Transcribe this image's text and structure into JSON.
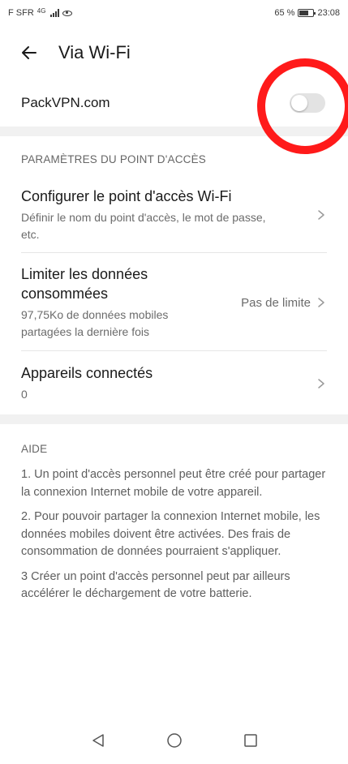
{
  "statusbar": {
    "carrier": "F SFR",
    "network": "4G",
    "battery": "65 %",
    "time": "23:08",
    "icons": [
      "signal-icon",
      "eye-icon",
      "battery-icon"
    ]
  },
  "appbar": {
    "title": "Via Wi-Fi",
    "back_icon": "back-arrow-icon"
  },
  "vpn": {
    "label": "PackVPN.com",
    "toggle_on": false
  },
  "hotspot": {
    "header": "PARAMÈTRES DU POINT D'ACCÈS",
    "items": [
      {
        "title": "Configurer le point d'accès Wi-Fi",
        "subtitle": "Définir le nom du point d'accès, le mot de passe, etc."
      },
      {
        "title": "Limiter les données consommées",
        "subtitle": "97,75Ko de données mobiles partagées la dernière fois",
        "value": "Pas de limite"
      },
      {
        "title": "Appareils connectés",
        "subtitle": "0"
      }
    ]
  },
  "help": {
    "header": "AIDE",
    "paragraphs": [
      "1. Un point d'accès personnel peut être créé pour partager la connexion Internet mobile de votre appareil.",
      "2. Pour pouvoir partager la connexion Internet mobile, les données mobiles doivent être activées. Des frais de consommation de données pourraient s'appliquer.",
      "3 Créer un point d'accès personnel peut par ailleurs accélérer le déchargement de votre batterie."
    ]
  },
  "navbar": {
    "icons": [
      "back-triangle-icon",
      "home-circle-icon",
      "recents-square-icon"
    ]
  },
  "colors": {
    "highlight": "#ff1a1a",
    "toggle_off": "#e3e3e3",
    "band": "#f1f1f1"
  }
}
